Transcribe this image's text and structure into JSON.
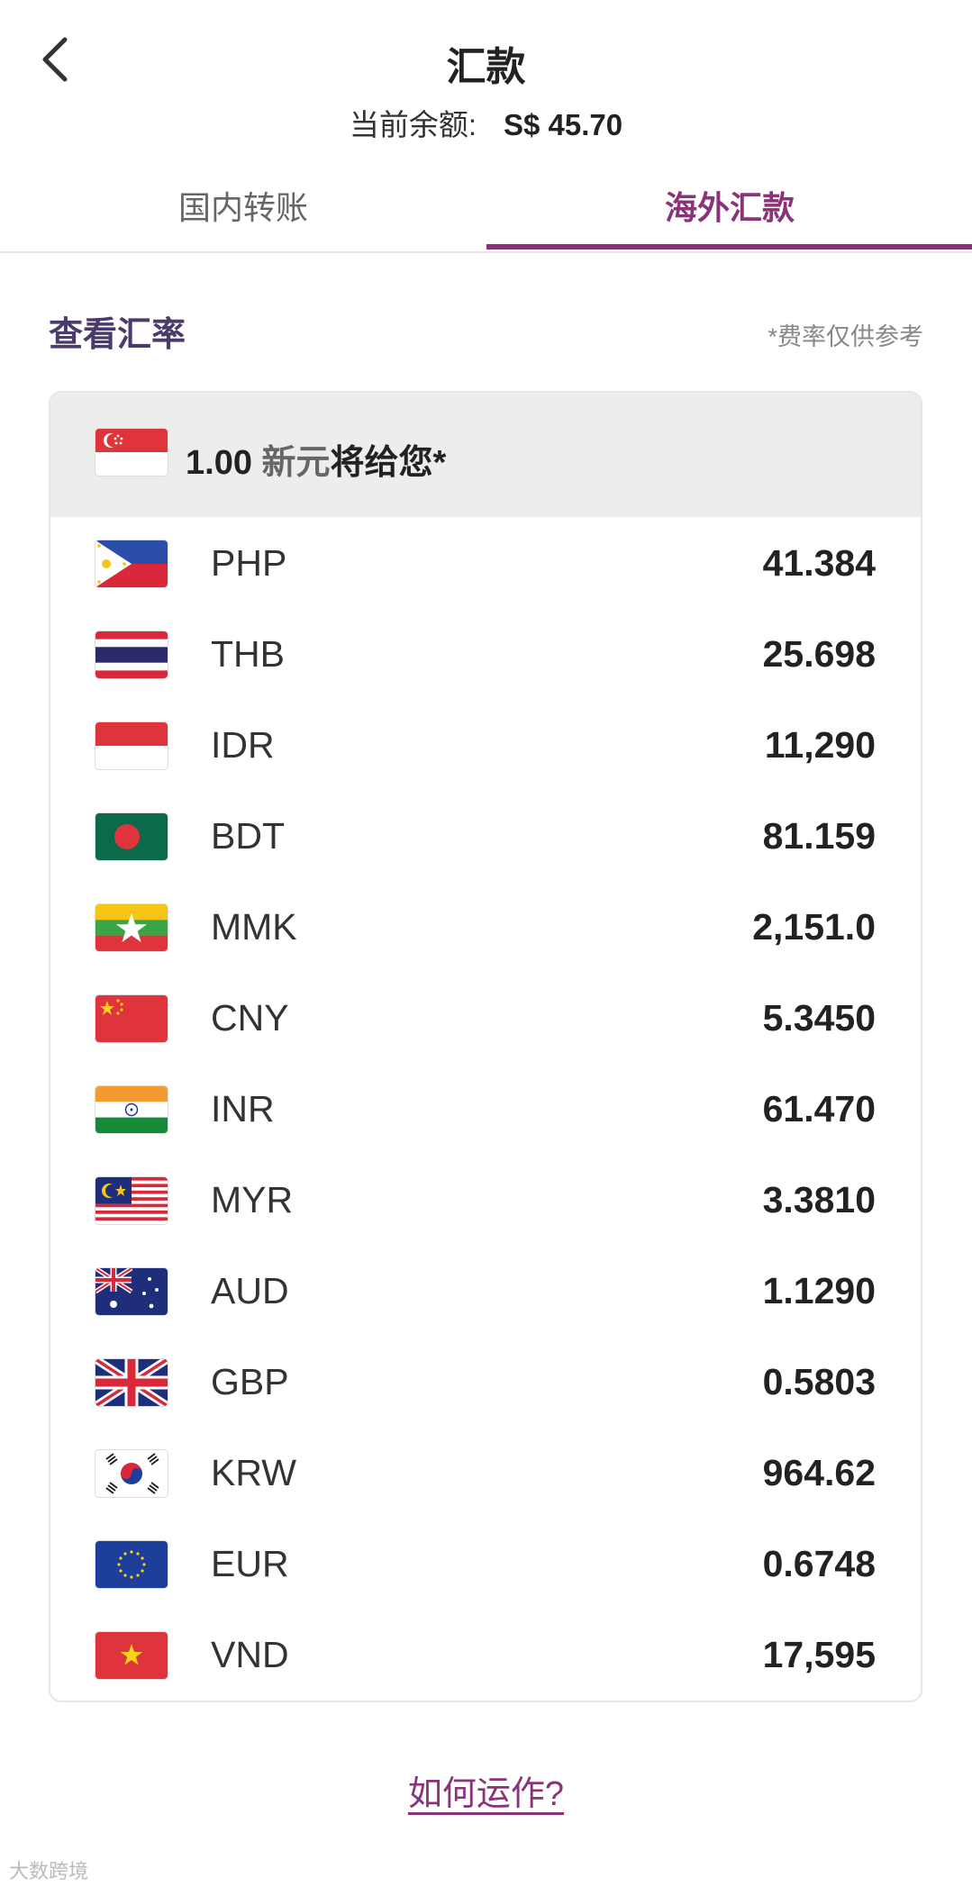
{
  "header": {
    "title": "汇款",
    "balance_label": "当前余额:",
    "balance_value": "S$ 45.70"
  },
  "tabs": [
    {
      "label": "国内转账",
      "active": false
    },
    {
      "label": "海外汇款",
      "active": true
    }
  ],
  "section": {
    "title": "查看汇率",
    "note": "*费率仅供参考"
  },
  "card_header": {
    "amount": "1.00",
    "currency": "新元",
    "suffix": "将给您*"
  },
  "rates": [
    {
      "code": "PHP",
      "rate": "41.384",
      "icon": "philippines-flag-icon"
    },
    {
      "code": "THB",
      "rate": "25.698",
      "icon": "thailand-flag-icon"
    },
    {
      "code": "IDR",
      "rate": "11,290",
      "icon": "indonesia-flag-icon"
    },
    {
      "code": "BDT",
      "rate": "81.159",
      "icon": "bangladesh-flag-icon"
    },
    {
      "code": "MMK",
      "rate": "2,151.0",
      "icon": "myanmar-flag-icon"
    },
    {
      "code": "CNY",
      "rate": "5.3450",
      "icon": "china-flag-icon"
    },
    {
      "code": "INR",
      "rate": "61.470",
      "icon": "india-flag-icon"
    },
    {
      "code": "MYR",
      "rate": "3.3810",
      "icon": "malaysia-flag-icon"
    },
    {
      "code": "AUD",
      "rate": "1.1290",
      "icon": "australia-flag-icon"
    },
    {
      "code": "GBP",
      "rate": "0.5803",
      "icon": "uk-flag-icon"
    },
    {
      "code": "KRW",
      "rate": "964.62",
      "icon": "korea-flag-icon"
    },
    {
      "code": "EUR",
      "rate": "0.6748",
      "icon": "eu-flag-icon"
    },
    {
      "code": "VND",
      "rate": "17,595",
      "icon": "vietnam-flag-icon"
    }
  ],
  "footer": {
    "how_it_works": "如何运作?"
  },
  "watermark": "大数跨境",
  "colors": {
    "accent": "#8a3378",
    "section_title": "#4b3a6a"
  }
}
